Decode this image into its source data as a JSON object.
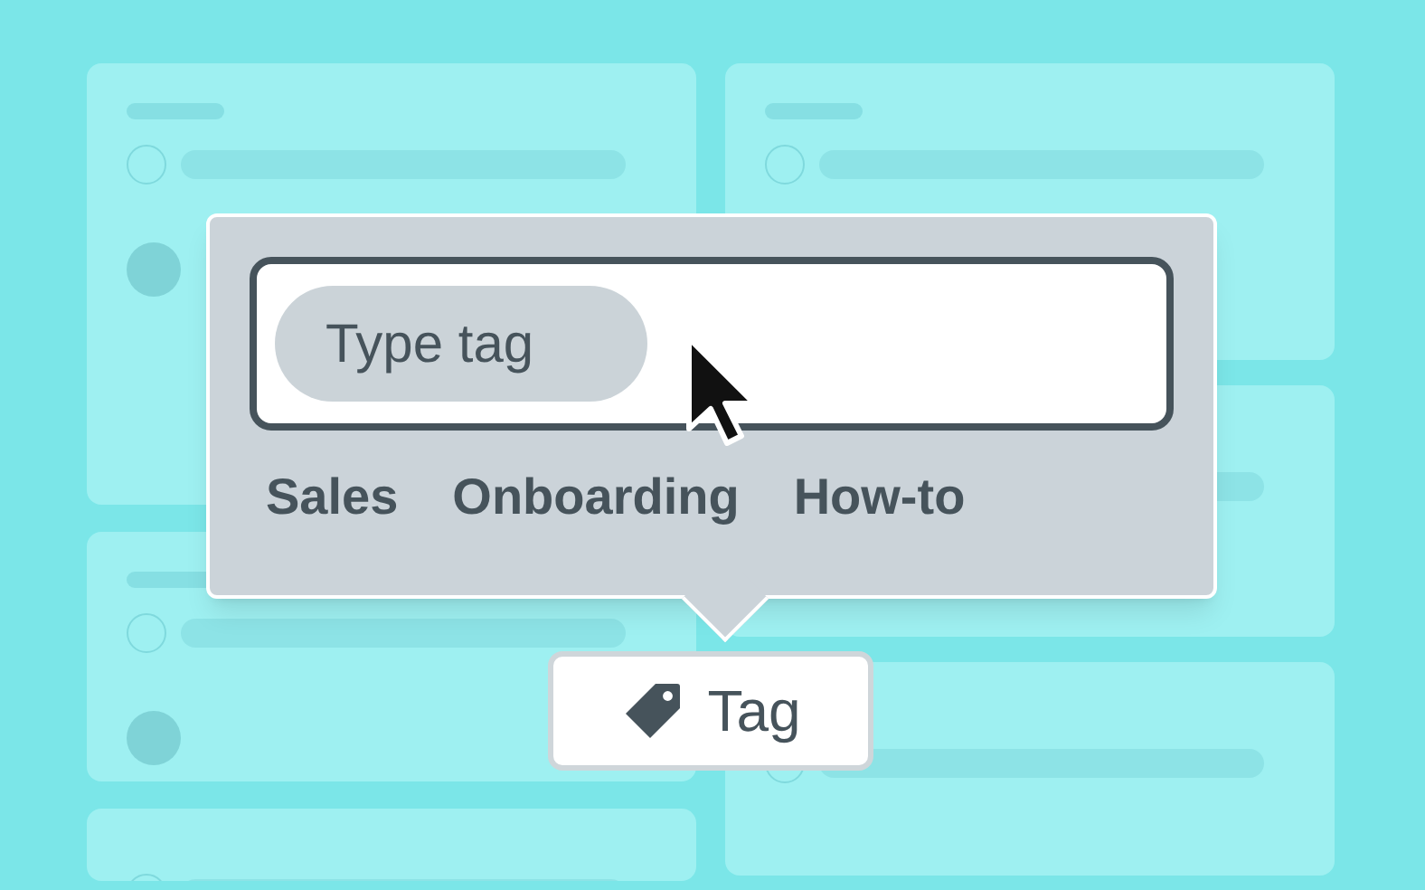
{
  "tag_input": {
    "placeholder": "Type tag"
  },
  "suggestions": [
    "Sales",
    "Onboarding",
    "How-to"
  ],
  "tag_button": {
    "label": "Tag"
  }
}
